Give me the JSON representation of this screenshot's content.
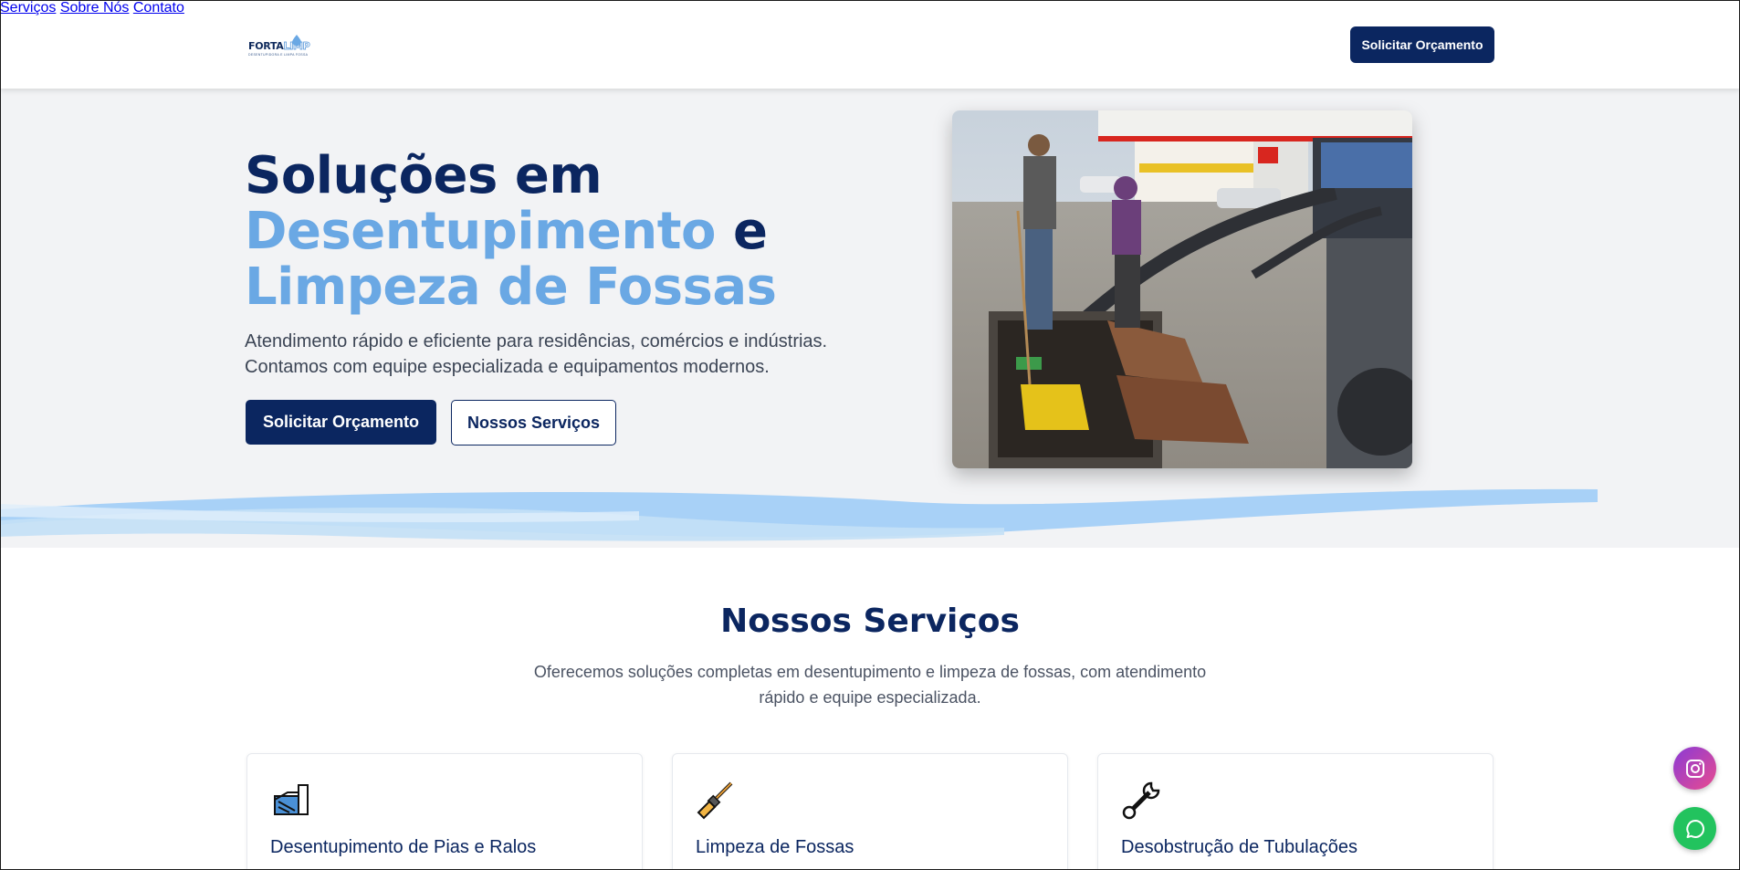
{
  "header": {
    "logo": {
      "word_a": "FORTA",
      "word_b": "LIMP",
      "tagline": "DESENTUPIDORA E LIMPA FOSSA"
    },
    "nav": [
      "Serviços",
      "Sobre Nós",
      "Contato"
    ],
    "cta_label": "Solicitar Orçamento"
  },
  "hero": {
    "title_line1": "Soluções em",
    "title_accent1": "Desentupimento",
    "title_connector": "e",
    "title_accent2": "Limpeza de Fossas",
    "subtitle_line1": "Atendimento rápido e eficiente para residências, comércios e indústrias.",
    "subtitle_line2": "Contamos com equipe especializada e equipamentos modernos.",
    "primary_button": "Solicitar Orçamento",
    "secondary_button": "Nossos Serviços"
  },
  "services": {
    "title": "Nossos Serviços",
    "subtitle_line1": "Oferecemos soluções completas em desentupimento e limpeza de fossas, com atendimento",
    "subtitle_line2": "rápido e equipe especializada.",
    "cards": [
      {
        "icon": "drain-pipe-icon",
        "title": "Desentupimento de Pias e Ralos"
      },
      {
        "icon": "broom-icon",
        "title": "Limpeza de Fossas"
      },
      {
        "icon": "wrench-icon",
        "title": "Desobstrução de Tubulações"
      }
    ]
  },
  "floating": {
    "instagram": "instagram-icon",
    "whatsapp": "whatsapp-icon"
  },
  "colors": {
    "navy": "#0b2660",
    "accent_blue": "#6aa8e4",
    "wave_blue": "#a8d1f7"
  }
}
